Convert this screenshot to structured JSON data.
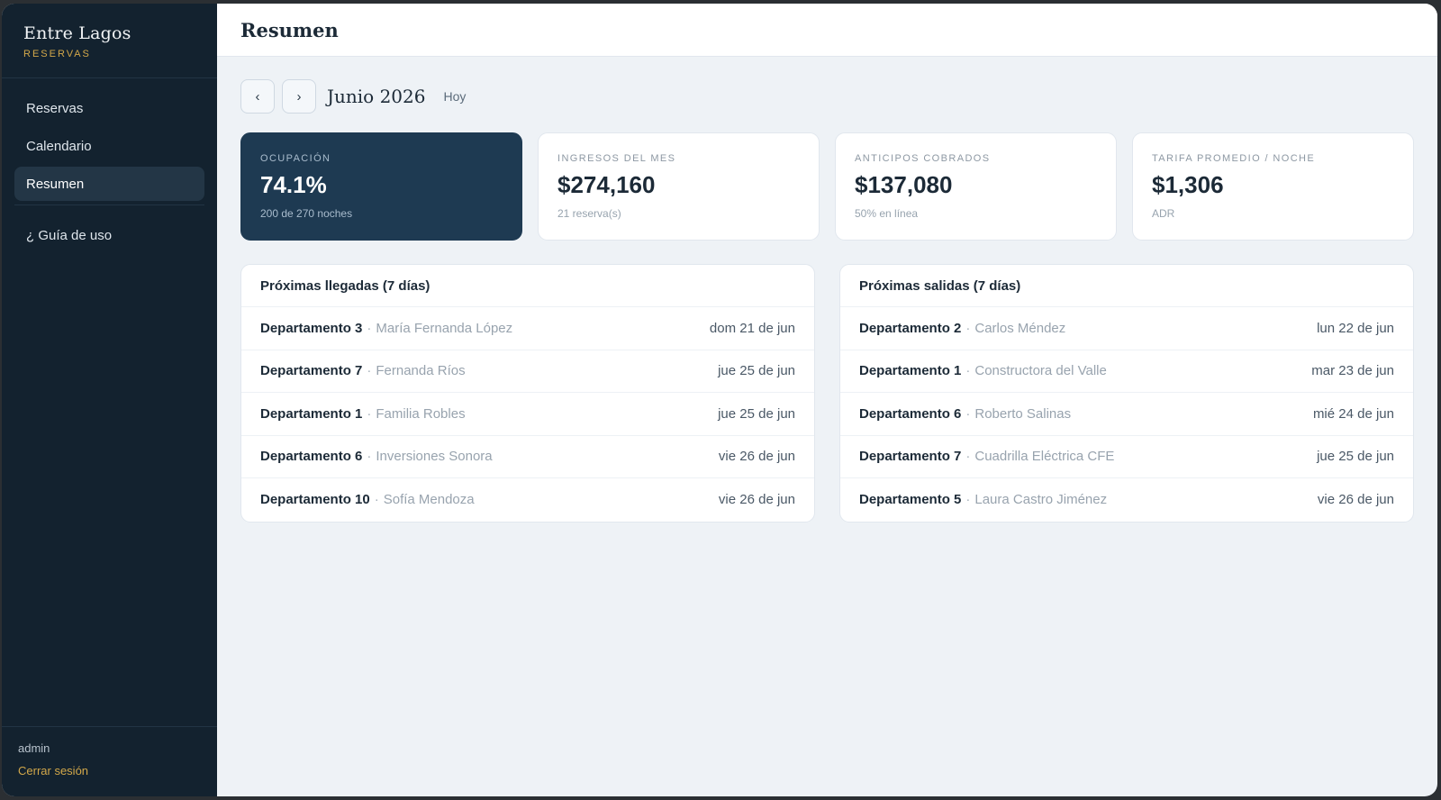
{
  "brand": {
    "name": "Entre Lagos",
    "subtitle": "RESERVAS"
  },
  "nav": {
    "items": [
      {
        "label": "Reservas",
        "active": false
      },
      {
        "label": "Calendario",
        "active": false
      },
      {
        "label": "Resumen",
        "active": true
      }
    ],
    "help_label": "¿ Guía de uso"
  },
  "footer": {
    "user": "admin",
    "logout_label": "Cerrar sesión"
  },
  "header": {
    "title": "Resumen"
  },
  "month_bar": {
    "prev_icon": "‹",
    "next_icon": "›",
    "month_label": "Junio 2026",
    "today_label": "Hoy"
  },
  "kpis": [
    {
      "label": "OCUPACIÓN",
      "value": "74.1%",
      "sub": "200 de 270 noches",
      "highlight": true
    },
    {
      "label": "INGRESOS DEL MES",
      "value": "$274,160",
      "sub": "21 reserva(s)",
      "highlight": false
    },
    {
      "label": "ANTICIPOS COBRADOS",
      "value": "$137,080",
      "sub": "50% en línea",
      "highlight": false
    },
    {
      "label": "TARIFA PROMEDIO / NOCHE",
      "value": "$1,306",
      "sub": "ADR",
      "highlight": false
    }
  ],
  "arrivals": {
    "title": "Próximas llegadas (7 días)",
    "rows": [
      {
        "unit": "Departamento 3",
        "guest": "María Fernanda López",
        "date": "dom 21 de jun"
      },
      {
        "unit": "Departamento 7",
        "guest": "Fernanda Ríos",
        "date": "jue 25 de jun"
      },
      {
        "unit": "Departamento 1",
        "guest": "Familia Robles",
        "date": "jue 25 de jun"
      },
      {
        "unit": "Departamento 6",
        "guest": "Inversiones Sonora",
        "date": "vie 26 de jun"
      },
      {
        "unit": "Departamento 10",
        "guest": "Sofía Mendoza",
        "date": "vie 26 de jun"
      }
    ]
  },
  "departures": {
    "title": "Próximas salidas (7 días)",
    "rows": [
      {
        "unit": "Departamento 2",
        "guest": "Carlos Méndez",
        "date": "lun 22 de jun"
      },
      {
        "unit": "Departamento 1",
        "guest": "Constructora del Valle",
        "date": "mar 23 de jun"
      },
      {
        "unit": "Departamento 6",
        "guest": "Roberto Salinas",
        "date": "mié 24 de jun"
      },
      {
        "unit": "Departamento 7",
        "guest": "Cuadrilla Eléctrica CFE",
        "date": "jue 25 de jun"
      },
      {
        "unit": "Departamento 5",
        "guest": "Laura Castro Jiménez",
        "date": "vie 26 de jun"
      }
    ]
  },
  "colors": {
    "sidebar_bg": "#13222f",
    "accent_gold": "#d3a84a",
    "highlight_card": "#1e3a52",
    "content_bg": "#eef2f6"
  }
}
